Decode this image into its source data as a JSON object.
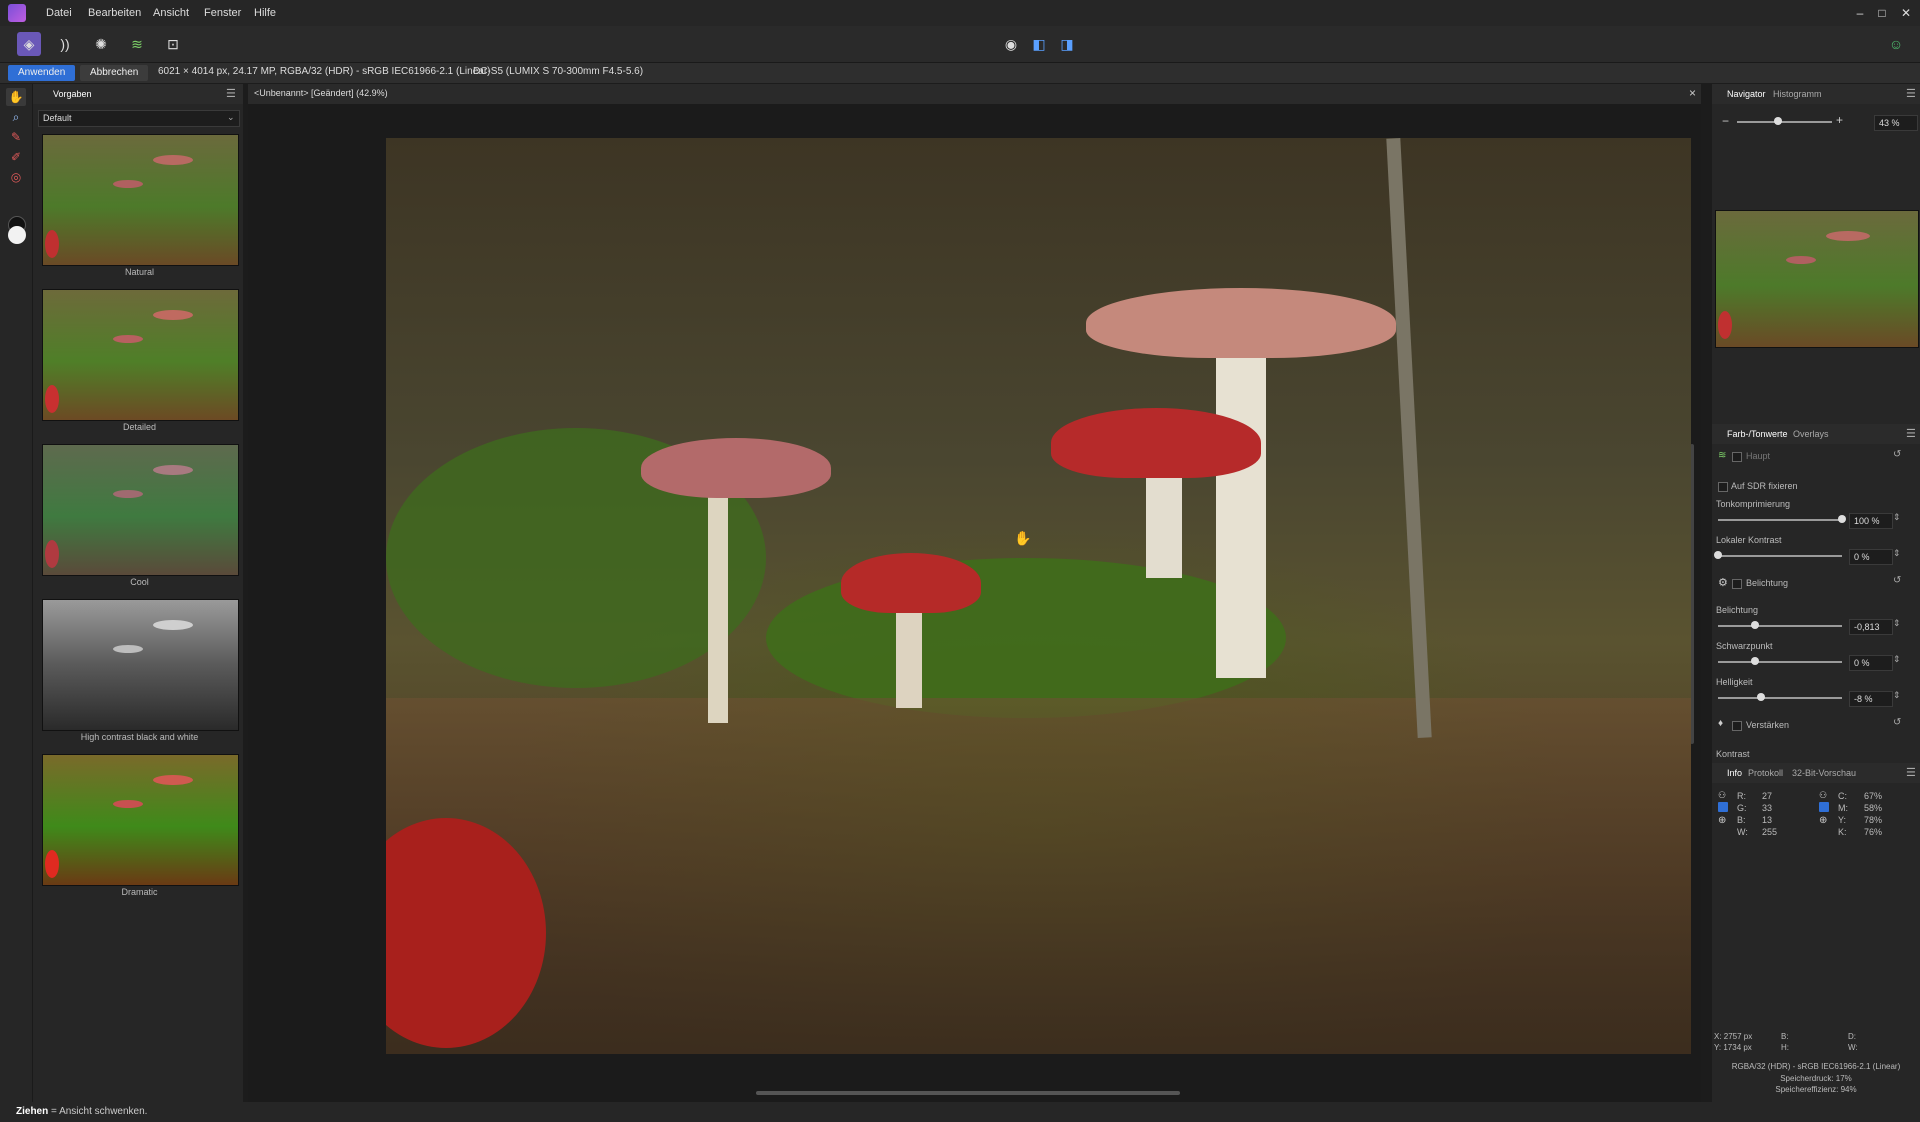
{
  "menubar": {
    "items": [
      "Datei",
      "Bearbeiten",
      "Ansicht",
      "Fenster",
      "Hilfe"
    ],
    "window_controls": [
      "–",
      "□",
      "✕"
    ]
  },
  "toolbar": {
    "persona_icons": [
      "photo-persona-icon",
      "liquify-persona-icon",
      "develop-persona-icon",
      "tone-mapping-persona-icon",
      "export-persona-icon"
    ],
    "view_icons": [
      "view-eye-icon",
      "split-view-icon",
      "mirror-view-icon"
    ]
  },
  "context": {
    "apply_label": "Anwenden",
    "cancel_label": "Abbrechen",
    "image_info": "6021 × 4014 px, 24.17 MP, RGBA/32 (HDR) - sRGB IEC61966-2.1 (Linear)",
    "camera_info": "DC-S5 (LUMIX S 70-300mm F4.5-5.6)"
  },
  "presets": {
    "tab": "Vorgaben",
    "dropdown": "Default",
    "items": [
      {
        "label": "Natural"
      },
      {
        "label": "Detailed"
      },
      {
        "label": "Cool"
      },
      {
        "label": "High contrast black and white"
      },
      {
        "label": "Dramatic"
      }
    ]
  },
  "document": {
    "tab_title": "<Unbenannt> [Geändert] (42.9%)",
    "close": "×"
  },
  "navigator": {
    "tabs": [
      "Navigator",
      "Histogramm"
    ],
    "zoom_value": "43 %",
    "zoom_fraction": 0.43
  },
  "tone": {
    "tabs": [
      "Farb-/Tonwerte",
      "Overlays"
    ],
    "haupt_label": "Haupt",
    "sdr_label": "Auf SDR fixieren",
    "tonkompression_label": "Tonkomprimierung",
    "tonkompression_value": "100 %",
    "tonkompression_fraction": 1.0,
    "lokaler_kontrast_label": "Lokaler Kontrast",
    "lokaler_kontrast_value": "0 %",
    "lokaler_kontrast_fraction": 0.0,
    "belichtung_group": "Belichtung",
    "belichtung_label": "Belichtung",
    "belichtung_value": "-0,813",
    "belichtung_fraction": 0.3,
    "schwarzpunkt_label": "Schwarzpunkt",
    "schwarzpunkt_value": "0 %",
    "schwarzpunkt_fraction": 0.3,
    "helligkeit_label": "Helligkeit",
    "helligkeit_value": "-8 %",
    "helligkeit_fraction": 0.35,
    "verstaerken_label": "Verstärken",
    "kontrast_label": "Kontrast"
  },
  "info": {
    "tabs": [
      "Info",
      "Protokoll",
      "32-Bit-Vorschau"
    ],
    "r_label": "R:",
    "r_value": "27",
    "g_label": "G:",
    "g_value": "33",
    "b_label": "B:",
    "b_value": "13",
    "w_label": "W:",
    "w_value": "255",
    "c_label": "C:",
    "c_value": "67%",
    "m_label": "M:",
    "m_value": "58%",
    "y_label": "Y:",
    "y_value": "78%",
    "k_label": "K:",
    "k_value": "76%",
    "x_pos": "X: 2757 px",
    "y_pos": "Y: 1734 px",
    "b2_label": "B:",
    "h_label": "H:",
    "d_label": "D:",
    "w2_label": "W:",
    "footer_line1": "RGBA/32 (HDR) - sRGB IEC61966-2.1 (Linear)",
    "footer_line2": "Speicherdruck: 17%",
    "footer_line3": "Speichereffizienz: 94%"
  },
  "status": {
    "bold": "Ziehen",
    "text": " = Ansicht schwenken."
  },
  "colors": {
    "accent": "#2f6fd6",
    "panel_bg": "#262626",
    "canvas_bg": "#1b1b1b"
  }
}
